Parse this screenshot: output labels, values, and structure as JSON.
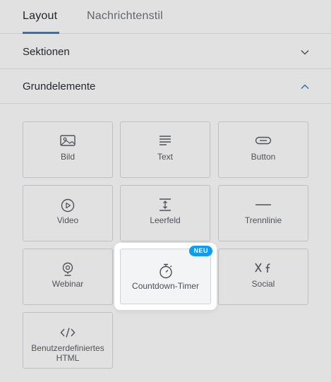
{
  "tabs": [
    {
      "label": "Layout",
      "active": true
    },
    {
      "label": "Nachrichtenstil",
      "active": false
    }
  ],
  "sections": [
    {
      "title": "Sektionen",
      "expanded": false
    },
    {
      "title": "Grundelemente",
      "expanded": true
    }
  ],
  "elements": [
    {
      "label": "Bild",
      "icon": "image-icon"
    },
    {
      "label": "Text",
      "icon": "text-lines-icon"
    },
    {
      "label": "Button",
      "icon": "button-pill-icon"
    },
    {
      "label": "Video",
      "icon": "play-circle-icon"
    },
    {
      "label": "Leerfeld",
      "icon": "spacer-icon"
    },
    {
      "label": "Trennlinie",
      "icon": "divider-line-icon"
    },
    {
      "label": "Webinar",
      "icon": "webcam-icon"
    },
    {
      "label": "Countdown-Timer",
      "icon": "stopwatch-icon",
      "badge": "NEU",
      "highlighted": true
    },
    {
      "label": "Social",
      "icon": "social-icons-icon"
    },
    {
      "label": "Benutzerdefiniertes HTML",
      "icon": "code-icon"
    }
  ],
  "colors": {
    "accent": "#2f7fcf",
    "badge": "#0f9bf0"
  }
}
